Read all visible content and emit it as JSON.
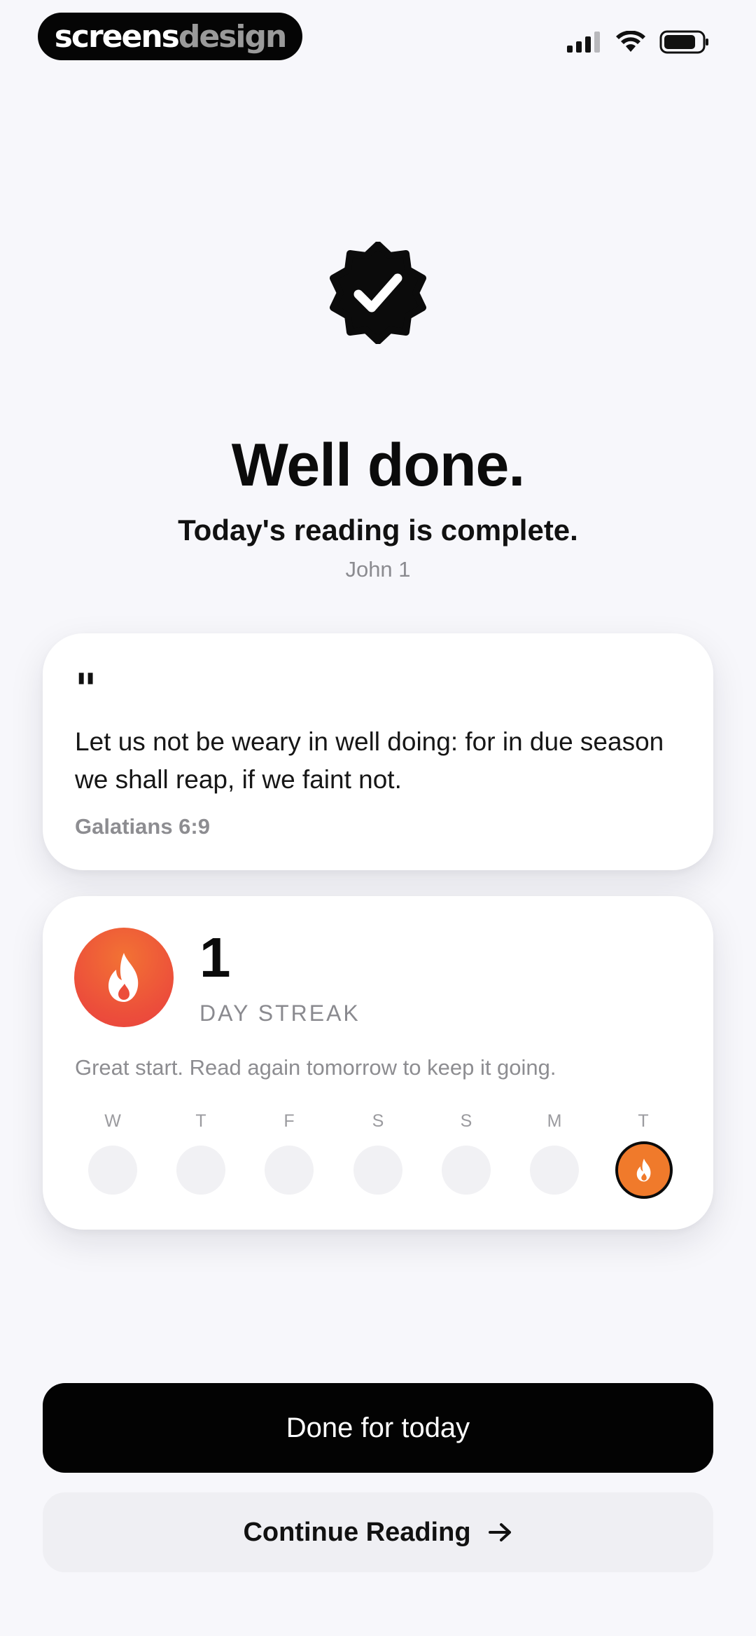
{
  "status_bar": {
    "brand_part1": "screens",
    "brand_part2": "design"
  },
  "completion": {
    "title": "Well done.",
    "subtitle": "Today's reading is complete.",
    "reading_ref": "John 1"
  },
  "quote": {
    "mark": "\"",
    "text": "Let us not be weary in well doing: for in due season we shall reap, if we faint not.",
    "reference": "Galatians 6:9"
  },
  "streak": {
    "count": "1",
    "label": "DAY STREAK",
    "message": "Great start. Read again tomorrow to keep it going.",
    "days": [
      {
        "letter": "W",
        "active": false
      },
      {
        "letter": "T",
        "active": false
      },
      {
        "letter": "F",
        "active": false
      },
      {
        "letter": "S",
        "active": false
      },
      {
        "letter": "S",
        "active": false
      },
      {
        "letter": "M",
        "active": false
      },
      {
        "letter": "T",
        "active": true
      }
    ]
  },
  "actions": {
    "primary_label": "Done for today",
    "secondary_label": "Continue Reading"
  },
  "colors": {
    "accent_orange": "#f07a2b",
    "flame_red": "#ec4d3b",
    "primary_button": "#030303"
  }
}
